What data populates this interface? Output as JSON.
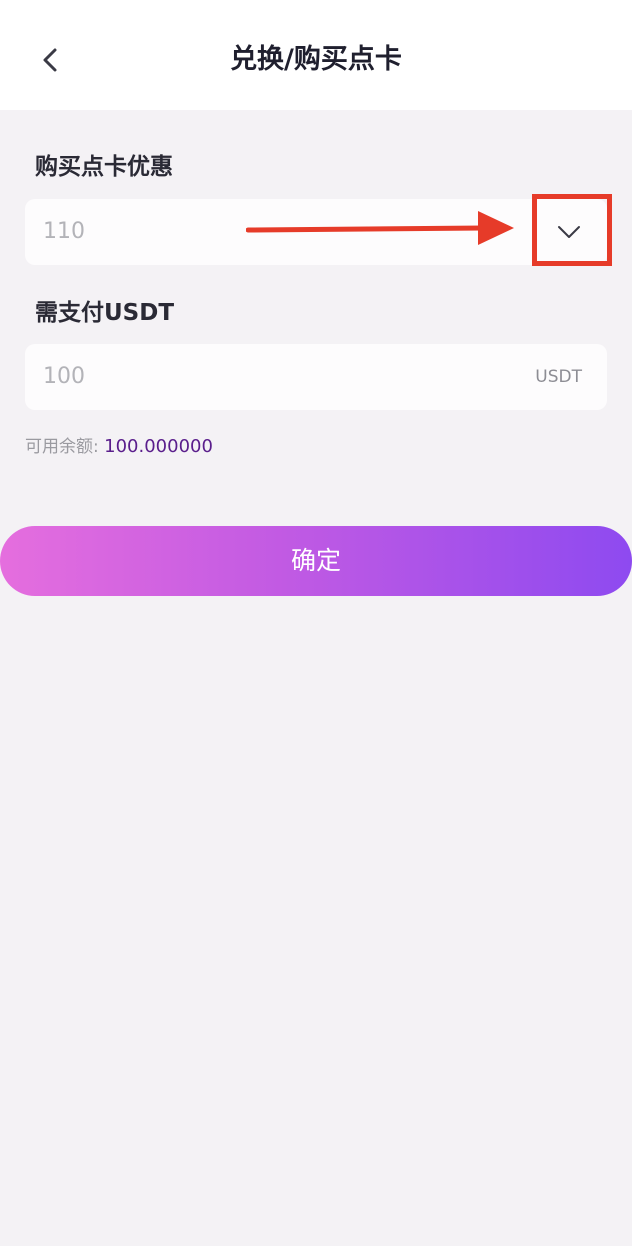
{
  "header": {
    "title": "兑换/购买点卡",
    "back_icon": "chevron-left-icon"
  },
  "discount_section": {
    "label": "购买点卡优惠",
    "value": "110",
    "dropdown_icon": "chevron-down-icon"
  },
  "payment_section": {
    "label": "需支付USDT",
    "value": "100",
    "unit": "USDT"
  },
  "balance": {
    "label": "可用余额:",
    "value": "100.000000"
  },
  "confirm_button": {
    "label": "确定"
  },
  "colors": {
    "accent_purple": "#5a1e8c",
    "button_gradient_start": "#e56ede",
    "button_gradient_end": "#8e4af0",
    "annotation_red": "#e63b29"
  }
}
